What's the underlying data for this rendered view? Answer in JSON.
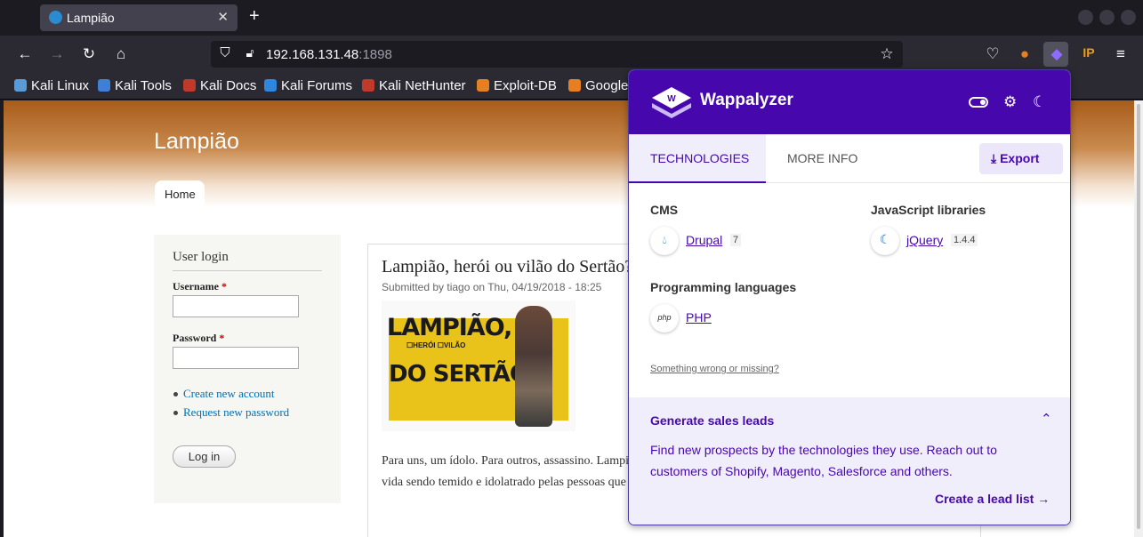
{
  "browser": {
    "tab_title": "Lampião",
    "new_tab": "+",
    "url_host": "192.168.131.48",
    "url_port": ":1898",
    "bookmarks": [
      {
        "label": "Kali Linux",
        "color": "#5b9bd5"
      },
      {
        "label": "Kali Tools",
        "color": "#3f7fd6"
      },
      {
        "label": "Kali Docs",
        "color": "#c0392b"
      },
      {
        "label": "Kali Forums",
        "color": "#2e86de"
      },
      {
        "label": "Kali NetHunter",
        "color": "#c0392b"
      },
      {
        "label": "Exploit-DB",
        "color": "#e67e22"
      },
      {
        "label": "Google",
        "color": "#e67e22"
      }
    ]
  },
  "site": {
    "name": "Lampião",
    "nav_home": "Home",
    "login": {
      "title": "User login",
      "username_label": "Username",
      "password_label": "Password",
      "required": "*",
      "create_account": "Create new account",
      "request_password": "Request new password",
      "submit": "Log in"
    },
    "article": {
      "title": "Lampião, herói ou vilão do Sertão?",
      "meta": "Submitted by tiago on Thu, 04/19/2018 - 18:25",
      "image_line1": "LAMPIÃO,",
      "image_sub": "☐HERÓI ☐VILÃO",
      "image_line2": "DO SERTÃO",
      "body_line1": "Para uns, um ídolo. Para outros, assassino. Lampi",
      "body_line2": "vida sendo temido e idolatrado pelas pessoas que"
    }
  },
  "wappalyzer": {
    "brand": "Wappalyzer",
    "tabs": {
      "technologies": "TECHNOLOGIES",
      "more_info": "MORE INFO"
    },
    "export": "Export",
    "categories": [
      {
        "name": "CMS",
        "tech": "Drupal",
        "version": "7",
        "icon": "drupal-icon"
      },
      {
        "name": "JavaScript libraries",
        "tech": "jQuery",
        "version": "1.4.4",
        "icon": "jquery-icon"
      },
      {
        "name": "Programming languages",
        "tech": "PHP",
        "version": "",
        "icon": "php-icon"
      }
    ],
    "wrong_link": "Something wrong or missing?",
    "leads": {
      "title": "Generate sales leads",
      "text": "Find new prospects by the technologies they use. Reach out to customers of Shopify, Magento, Salesforce and others.",
      "link": "Create a lead list"
    },
    "accent": "#4608ad"
  }
}
